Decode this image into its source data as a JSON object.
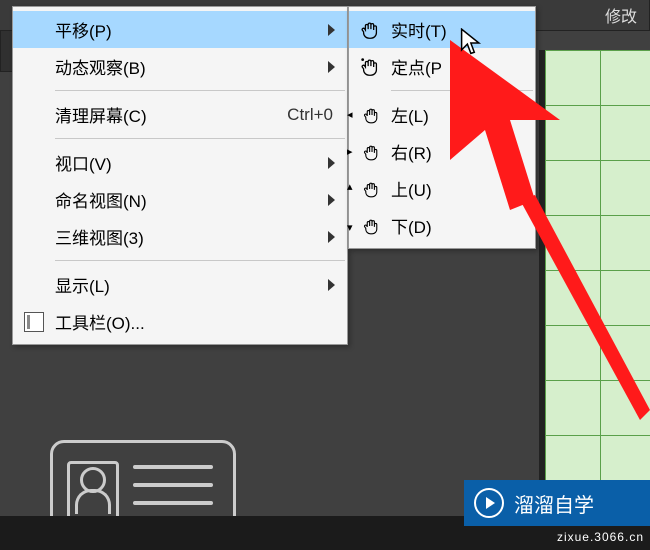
{
  "topbar": {
    "modify_label": "修改"
  },
  "main_menu": [
    {
      "label": "平移(P)",
      "has_sub": true,
      "highlight": true
    },
    {
      "label": "动态观察(B)",
      "has_sub": true
    },
    {
      "sep": true
    },
    {
      "label": "清理屏幕(C)",
      "shortcut": "Ctrl+0"
    },
    {
      "sep": true
    },
    {
      "label": "视口(V)",
      "has_sub": true
    },
    {
      "label": "命名视图(N)",
      "has_sub": true
    },
    {
      "label": "三维视图(3)",
      "has_sub": true
    },
    {
      "sep": true
    },
    {
      "label": "显示(L)",
      "has_sub": true
    },
    {
      "label": "工具栏(O)...",
      "icon": "toolbar"
    }
  ],
  "sub_menu": [
    {
      "label": "实时(T)",
      "icon": "hand",
      "highlight": true
    },
    {
      "label": "定点(P",
      "icon": "hand-dot"
    },
    {
      "sep": true
    },
    {
      "label": "左(L)",
      "icon": "hand-left"
    },
    {
      "label": "右(R)",
      "icon": "hand-right"
    },
    {
      "label": "上(U)",
      "icon": "hand-up"
    },
    {
      "label": "下(D)",
      "icon": "hand-down"
    }
  ],
  "watermark": {
    "brand": "溜溜自学",
    "url": "zixue.3066.cn"
  }
}
